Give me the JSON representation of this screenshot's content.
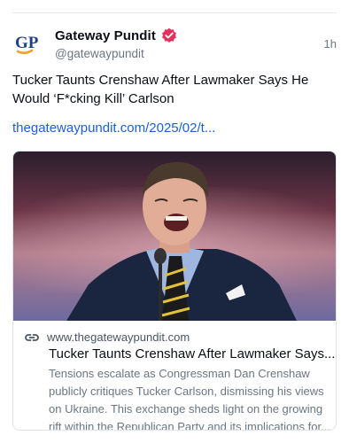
{
  "post": {
    "author_name": "Gateway Pundit",
    "handle": "@gatewaypundit",
    "time": "1h",
    "avatar_initials": "GP",
    "text": "Tucker Taunts Crenshaw After Lawmaker Says He Would ‘F*cking Kill’ Carlson",
    "link_text": "thegatewaypundit.com/2025/02/t..."
  },
  "embed": {
    "domain": "www.thegatewaypundit.com",
    "title": "Tucker Taunts Crenshaw After Lawmaker Says...",
    "description": "Tensions escalate as Congressman Dan Crenshaw publicly critiques Tucker Carlson, dismissing his views on Ukraine. This exchange sheds light on the growing rift within the Republican Party and its implications for..."
  },
  "icons": {
    "verified": "verified-badge-icon",
    "link": "link-icon"
  },
  "colors": {
    "link": "#1d5fd8",
    "verified": "#e8305c",
    "avatar_blue": "#1f3f86",
    "avatar_orange": "#f0a12b"
  }
}
